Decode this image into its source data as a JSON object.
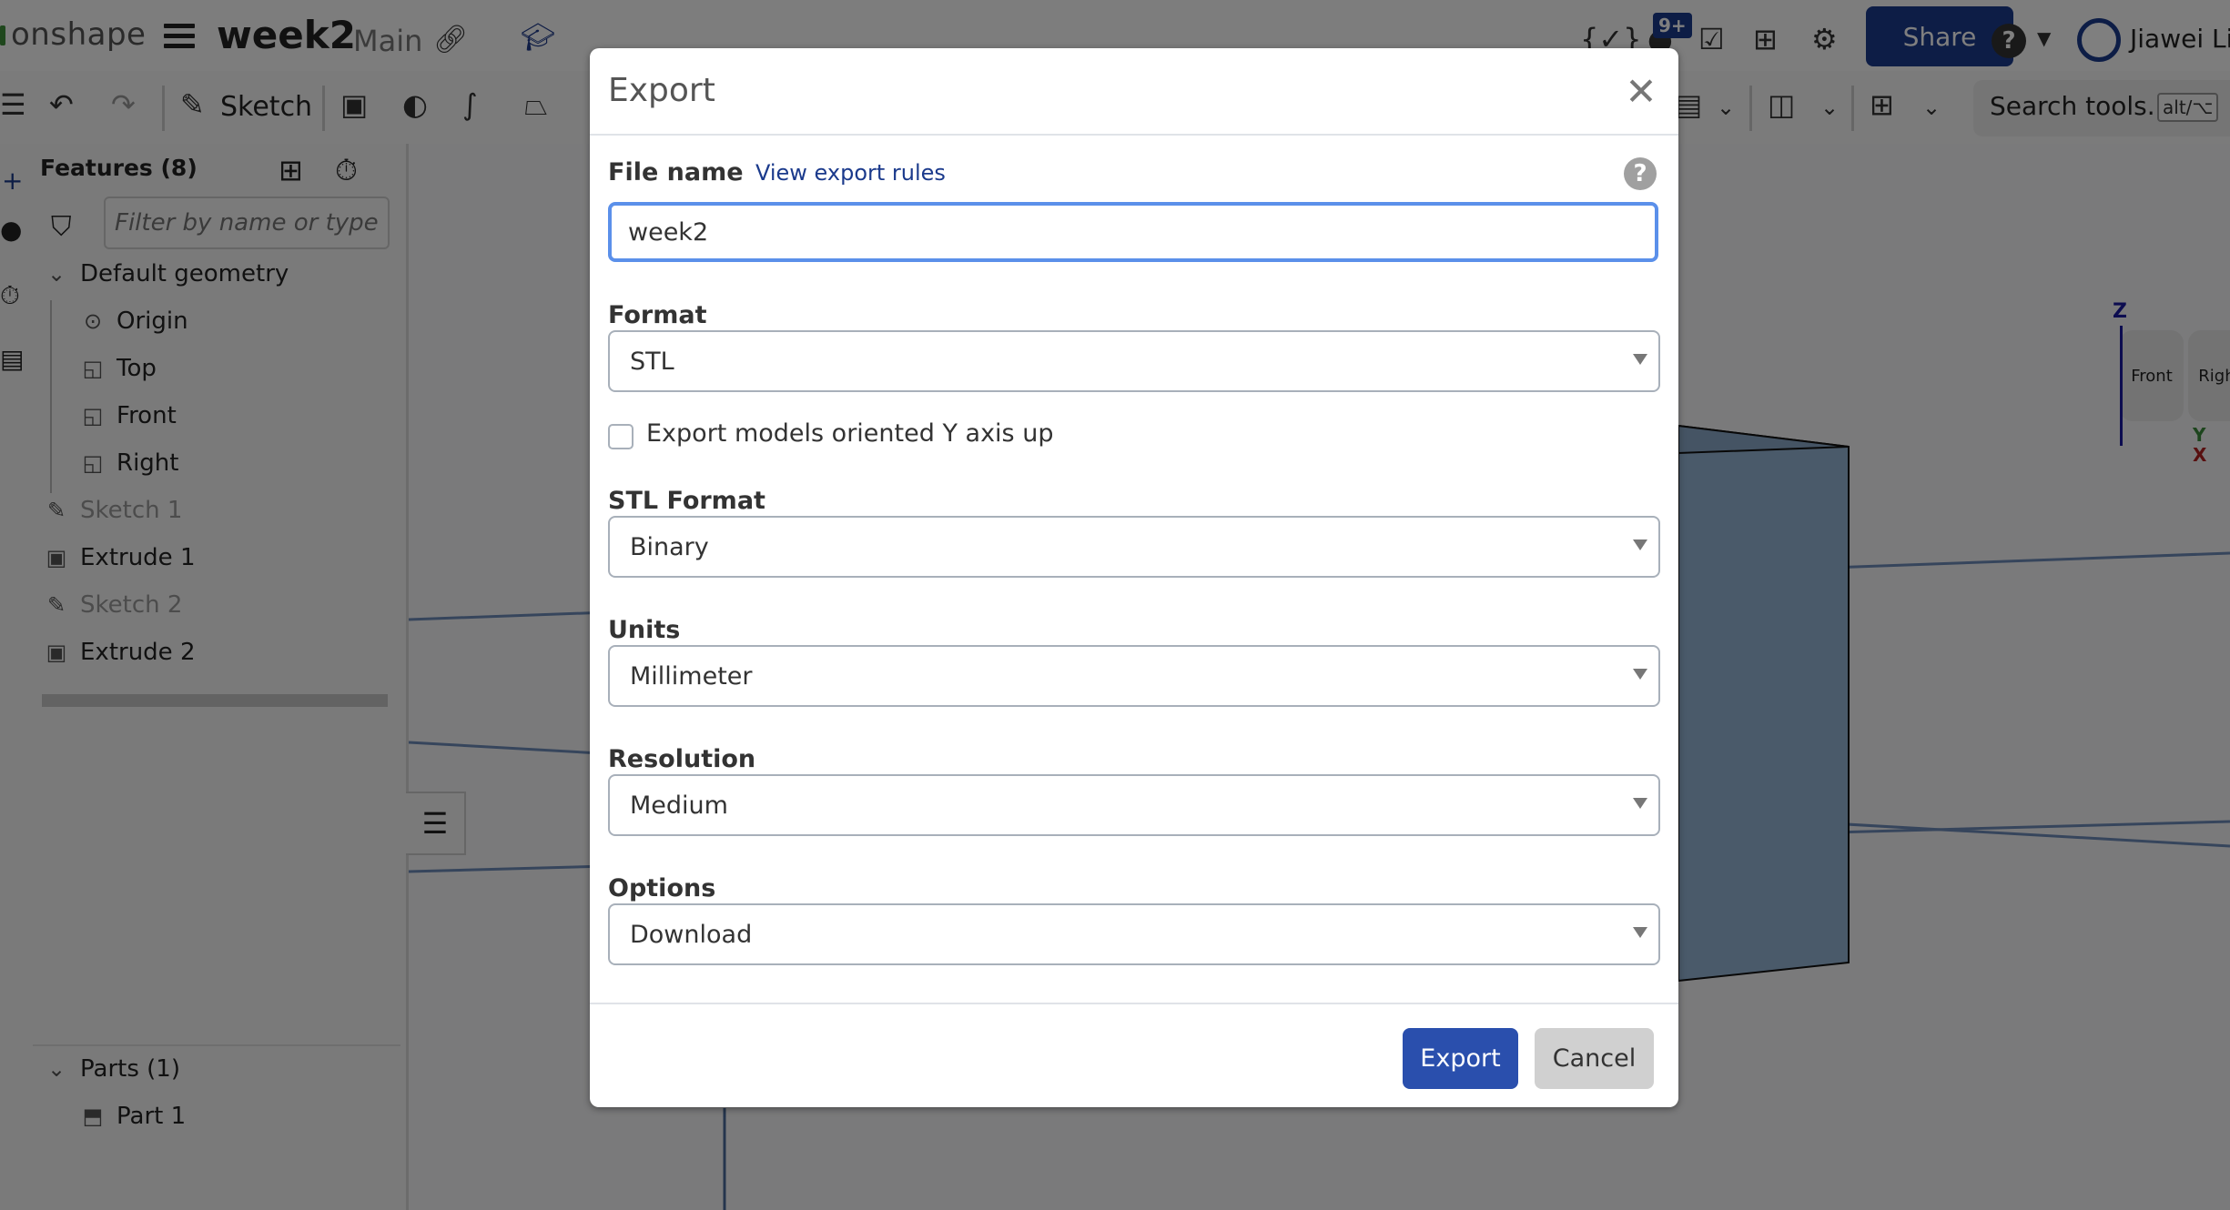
{
  "app": {
    "logo_text": "onshape",
    "document_title": "week2",
    "branch": "Main",
    "notification_badge": "9+",
    "share_label": "Share",
    "user_name": "Jiawei Li",
    "brand_color": "#1b3a8c"
  },
  "toolbar": {
    "sketch_label": "Sketch",
    "search_placeholder": "Search tools...",
    "search_shortcut": "alt/⌥"
  },
  "feature_panel": {
    "title": "Features (8)",
    "filter_placeholder": "Filter by name or type",
    "groups": [
      {
        "label": "Default geometry",
        "expanded": true
      },
      {
        "label": "Parts (1)",
        "expanded": true
      }
    ],
    "default_geometry": [
      {
        "label": "Origin",
        "icon": "origin-icon"
      },
      {
        "label": "Top",
        "icon": "plane-icon"
      },
      {
        "label": "Front",
        "icon": "plane-icon"
      },
      {
        "label": "Right",
        "icon": "plane-icon"
      }
    ],
    "features": [
      {
        "label": "Sketch 1",
        "icon": "sketch-icon",
        "dimmed": true
      },
      {
        "label": "Extrude 1",
        "icon": "extrude-icon",
        "dimmed": false
      },
      {
        "label": "Sketch 2",
        "icon": "sketch-icon",
        "dimmed": true
      },
      {
        "label": "Extrude 2",
        "icon": "extrude-icon",
        "dimmed": false
      }
    ],
    "parts": [
      {
        "label": "Part 1",
        "icon": "part-icon"
      }
    ]
  },
  "view_cube": {
    "faces": [
      "Front",
      "Right"
    ],
    "axes": [
      "Z",
      "Y",
      "X"
    ]
  },
  "dialog": {
    "title": "Export",
    "file_name_label": "File name",
    "export_rules_link": "View export rules",
    "file_name_value": "week2",
    "format_label": "Format",
    "format_value": "STL",
    "y_axis_up_label": "Export models oriented Y axis up",
    "y_axis_up_checked": false,
    "stl_format_label": "STL Format",
    "stl_format_value": "Binary",
    "units_label": "Units",
    "units_value": "Millimeter",
    "resolution_label": "Resolution",
    "resolution_value": "Medium",
    "options_label": "Options",
    "options_value": "Download",
    "export_button": "Export",
    "cancel_button": "Cancel",
    "primary_color": "#2a4fad",
    "focus_color": "#5b90ea"
  }
}
